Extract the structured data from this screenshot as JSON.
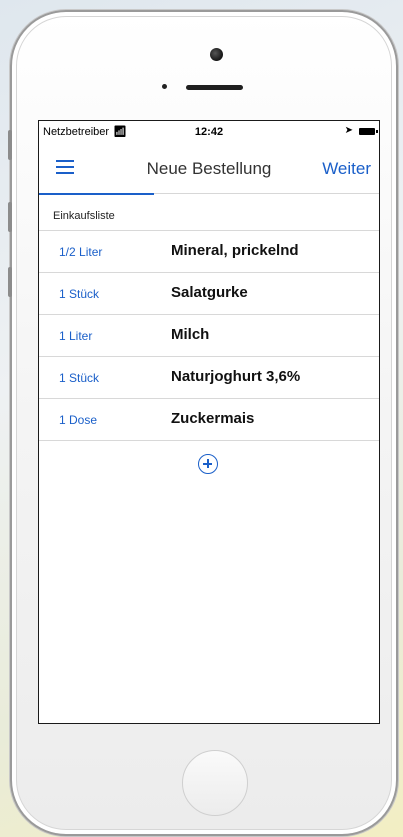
{
  "status_bar": {
    "carrier": "Netzbetreiber",
    "time": "12:42",
    "wifi_icon": "wifi-icon",
    "location_icon": "location-arrow-icon",
    "battery_icon": "battery-icon"
  },
  "nav": {
    "menu_icon": "hamburger-menu-icon",
    "title": "Neue Bestellung",
    "next_label": "Weiter"
  },
  "list": {
    "section_label": "Einkaufsliste",
    "items": [
      {
        "quantity": "1/2 Liter",
        "name": "Mineral, prickelnd"
      },
      {
        "quantity": "1 Stück",
        "name": "Salatgurke"
      },
      {
        "quantity": "1 Liter",
        "name": "Milch"
      },
      {
        "quantity": "1 Stück",
        "name": "Naturjoghurt 3,6%"
      },
      {
        "quantity": "1 Dose",
        "name": "Zuckermais"
      }
    ]
  },
  "add_icon": "plus-circle-icon",
  "colors": {
    "accent": "#1a5fc9",
    "text": "#111111",
    "divider": "#d8d8d8"
  }
}
